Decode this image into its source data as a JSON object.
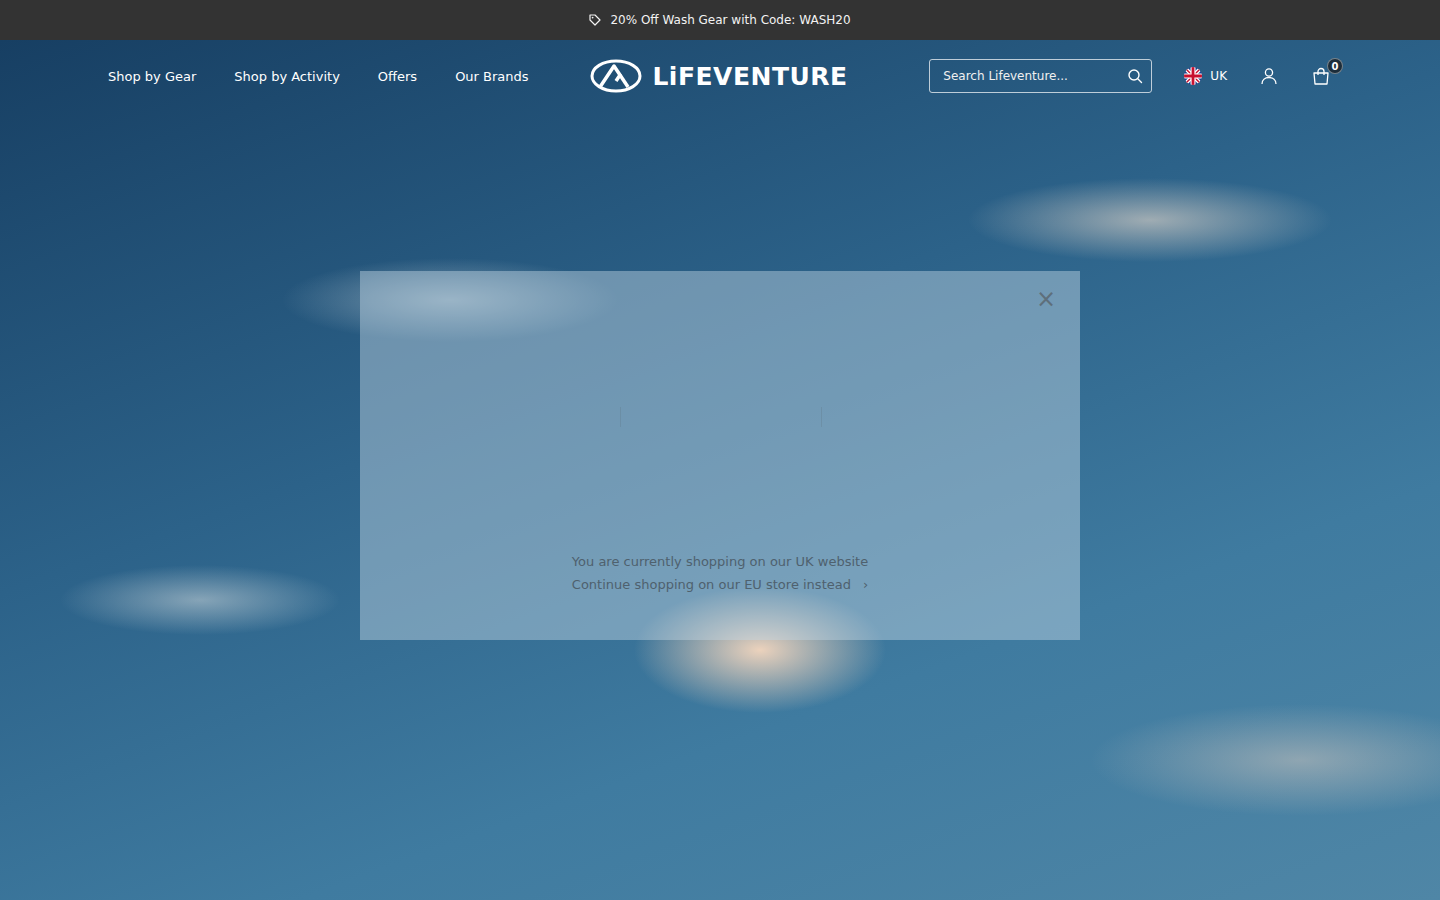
{
  "announcement": {
    "text": "20% Off Wash Gear with Code: WASH20"
  },
  "nav": [
    {
      "label": "Shop by Gear"
    },
    {
      "label": "Shop by Activity"
    },
    {
      "label": "Offers"
    },
    {
      "label": "Our Brands"
    }
  ],
  "logo": {
    "text": "LiFEVENTURE"
  },
  "search": {
    "placeholder": "Search Lifeventure..."
  },
  "region": {
    "label": "UK"
  },
  "cart": {
    "count": "0"
  },
  "modal": {
    "close": "×",
    "message": "You are currently shopping on our UK website",
    "link": "Continue shopping on our EU store instead",
    "link_arrow": "›"
  }
}
